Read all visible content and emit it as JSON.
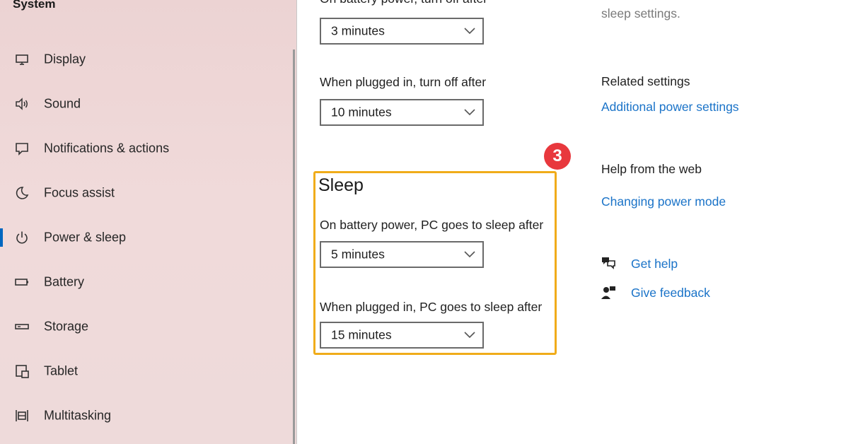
{
  "sidebar": {
    "title": "System",
    "items": [
      {
        "label": "Display",
        "icon": "display-icon",
        "active": false
      },
      {
        "label": "Sound",
        "icon": "sound-icon",
        "active": false
      },
      {
        "label": "Notifications & actions",
        "icon": "notifications-icon",
        "active": false
      },
      {
        "label": "Focus assist",
        "icon": "focus-assist-icon",
        "active": false
      },
      {
        "label": "Power & sleep",
        "icon": "power-icon",
        "active": true
      },
      {
        "label": "Battery",
        "icon": "battery-icon",
        "active": false
      },
      {
        "label": "Storage",
        "icon": "storage-icon",
        "active": false
      },
      {
        "label": "Tablet",
        "icon": "tablet-icon",
        "active": false
      },
      {
        "label": "Multitasking",
        "icon": "multitasking-icon",
        "active": false
      }
    ]
  },
  "screen": {
    "battery_label": "On battery power, turn off after",
    "battery_value": "3 minutes",
    "plugged_label": "When plugged in, turn off after",
    "plugged_value": "10 minutes"
  },
  "sleep": {
    "heading": "Sleep",
    "battery_label": "On battery power, PC goes to sleep after",
    "battery_value": "5 minutes",
    "plugged_label": "When plugged in, PC goes to sleep after",
    "plugged_value": "15 minutes",
    "step_badge": "3"
  },
  "right": {
    "top_text": "sleep settings.",
    "related_heading": "Related settings",
    "related_link": "Additional power settings",
    "web_heading": "Help from the web",
    "web_link": "Changing power mode",
    "get_help": "Get help",
    "give_feedback": "Give feedback"
  },
  "colors": {
    "accent": "#0067c0",
    "link": "#1a73c8",
    "highlight": "#f0ac1a",
    "badge": "#e8383d"
  }
}
